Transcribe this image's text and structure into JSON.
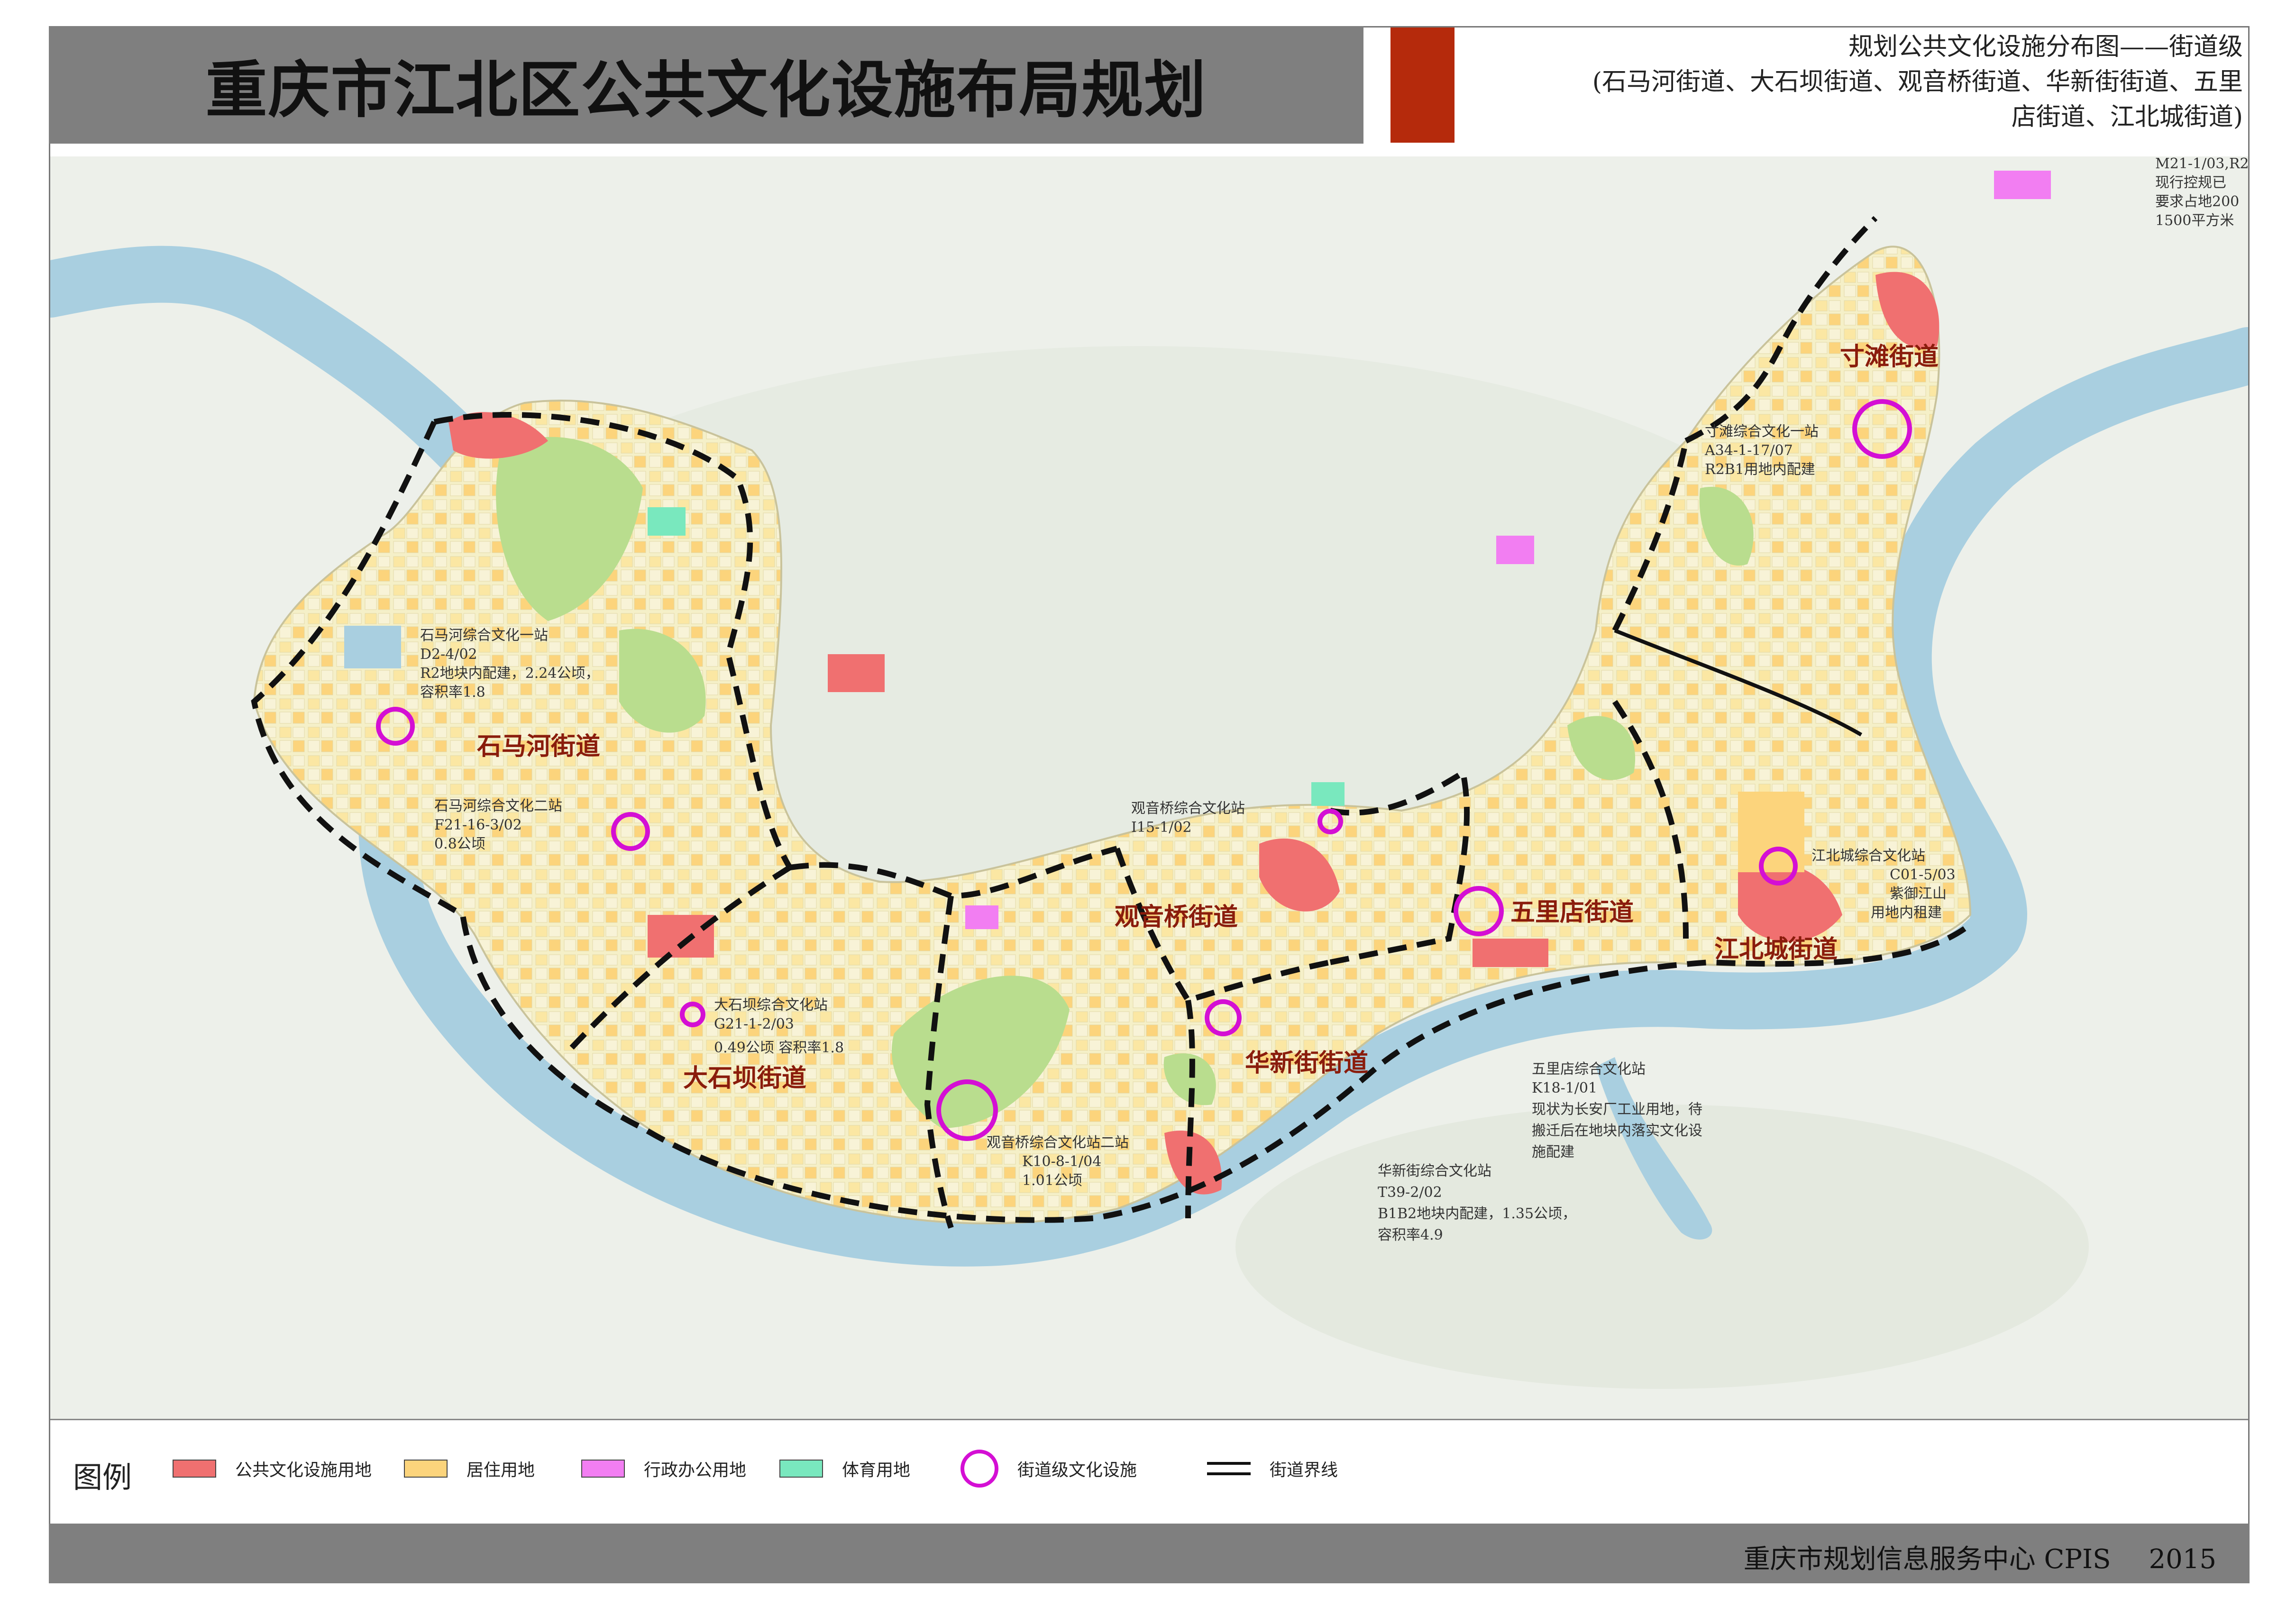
{
  "header": {
    "title": "重庆市江北区公共文化设施布局规划",
    "subtitle_lines": [
      "规划公共文化设施分布图——街道级",
      "(石马河街道、大石坝街道、观音桥街道、华新街街道、五里",
      "店街道、江北城街道)"
    ],
    "accent_color": "#b52a0c"
  },
  "map": {
    "districts": [
      {
        "name": "石马河街道"
      },
      {
        "name": "大石坝街道"
      },
      {
        "name": "观音桥街道"
      },
      {
        "name": "华新街街道"
      },
      {
        "name": "五里店街道"
      },
      {
        "name": "江北城街道"
      },
      {
        "name": "寸滩街道"
      }
    ],
    "stations": [
      {
        "lines": [
          "石马河综合文化一站",
          "D2-4/02",
          "R2地块内配建，2.24公顷，",
          "容积率1.8"
        ]
      },
      {
        "lines": [
          "石马河综合文化二站",
          "F21-16-3/02",
          "0.8公顷"
        ]
      },
      {
        "lines": [
          "大石坝综合文化站",
          "G21-1-2/03",
          "0.49公顷  容积率1.8"
        ]
      },
      {
        "lines": [
          "观音桥综合文化站",
          "I15-1/02"
        ]
      },
      {
        "lines": [
          "观音桥综合文化站二站",
          "K10-8-1/04",
          "1.01公顷"
        ]
      },
      {
        "lines": [
          "华新街综合文化站",
          "T39-2/02",
          "B1B2地块内配建，1.35公顷，",
          "容积率4.9"
        ]
      },
      {
        "lines": [
          "五里店综合文化站",
          "K18-1/01",
          "现状为长安厂工业用地，待",
          "搬迁后在地块内落实文化设",
          "施配建"
        ]
      },
      {
        "lines": [
          "江北城综合文化站",
          "C01-5/03",
          "紫御江山",
          "用地内租建"
        ]
      },
      {
        "lines": [
          "寸滩综合文化一站",
          "A34-1-17/07",
          "R2B1用地内配建"
        ]
      }
    ],
    "corner_note": [
      "M21-1/03,R2",
      "现行控规已",
      "要求占地200",
      "1500平方米"
    ],
    "colors": {
      "river": "#a9cfe0",
      "urban": "#f5f0c8",
      "culture": "#f07070",
      "green": "#b9dd8e",
      "station_ring": "#d40fd4",
      "boundary": "#111111"
    }
  },
  "legend": {
    "title": "图例",
    "items": [
      {
        "label": "公共文化设施用地",
        "color": "#f07070"
      },
      {
        "label": "居住用地",
        "color": "#fcd47c"
      },
      {
        "label": "行政办公用地",
        "color": "#f27ef2"
      },
      {
        "label": "体育用地",
        "color": "#79e8be"
      },
      {
        "label": "街道级文化设施",
        "color": "#d40fd4"
      },
      {
        "label": "街道界线",
        "color": "#111111"
      }
    ]
  },
  "footer": {
    "org": "重庆市规划信息服务中心 CPIS",
    "year": "2015"
  }
}
